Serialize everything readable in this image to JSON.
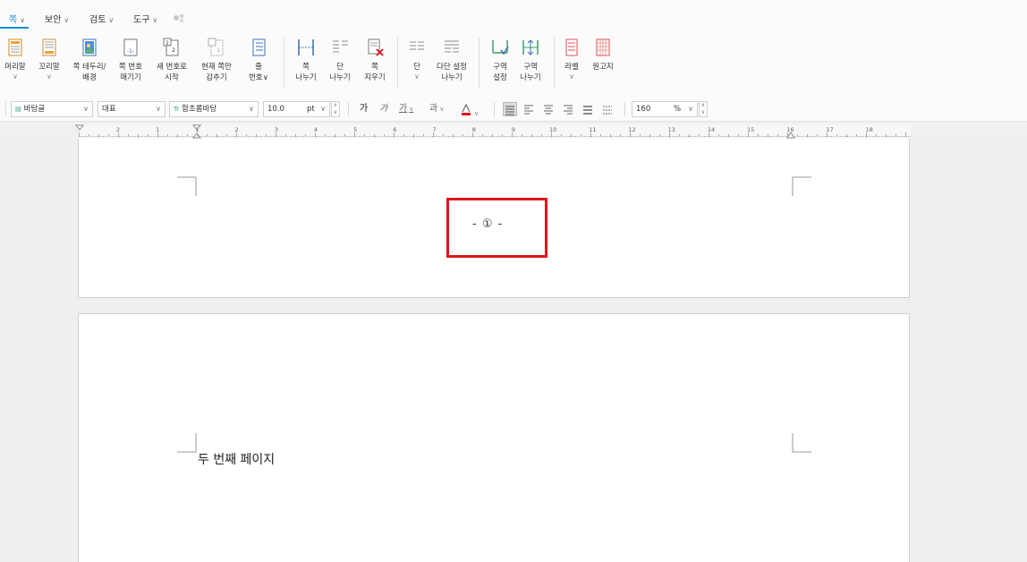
{
  "menu": {
    "tabs": [
      {
        "label": "쪽",
        "active": true
      },
      {
        "label": "보안",
        "active": false
      },
      {
        "label": "검토",
        "active": false
      },
      {
        "label": "도구",
        "active": false
      }
    ]
  },
  "ribbon": {
    "buttons": [
      {
        "label": "머리말",
        "icon": "header-icon",
        "dropdown": true
      },
      {
        "label": "꼬리말",
        "icon": "footer-icon",
        "dropdown": true
      },
      {
        "label": "쪽 테두리/\n배경",
        "icon": "page-border-icon",
        "dropdown": false
      },
      {
        "label": "쪽 번호\n매기기",
        "icon": "page-number-icon",
        "dropdown": false
      },
      {
        "label": "새 번호로\n시작",
        "icon": "new-number-icon",
        "dropdown": false
      },
      {
        "label": "현재 쪽만\n감추기",
        "icon": "hide-page-icon",
        "dropdown": false
      },
      {
        "label": "줄\n번호∨",
        "icon": "line-number-icon",
        "dropdown": false
      },
      {
        "label": "쪽\n나누기",
        "icon": "page-break-icon",
        "dropdown": false
      },
      {
        "label": "단\n나누기",
        "icon": "column-break-icon",
        "dropdown": false
      },
      {
        "label": "쪽\n지우기",
        "icon": "delete-page-icon",
        "dropdown": false
      },
      {
        "label": "단",
        "icon": "columns-icon",
        "dropdown": true
      },
      {
        "label": "다단 설정\n나누기",
        "icon": "multi-column-icon",
        "dropdown": false
      },
      {
        "label": "구역\n설정",
        "icon": "section-settings-icon",
        "dropdown": false
      },
      {
        "label": "구역\n나누기",
        "icon": "section-break-icon",
        "dropdown": false
      },
      {
        "label": "라벨",
        "icon": "label-icon",
        "dropdown": true
      },
      {
        "label": "원고지",
        "icon": "manuscript-icon",
        "dropdown": false
      }
    ]
  },
  "format": {
    "style": "바탕글",
    "language": "대표",
    "font": "함초롬바탕",
    "font_size": "10.0",
    "size_unit": "pt",
    "char_buttons": [
      "가",
      "가",
      "가",
      "과"
    ],
    "line_spacing": "160",
    "line_spacing_unit": "%"
  },
  "ruler": {
    "numbers": [
      "2",
      "1",
      "1",
      "2",
      "3",
      "4",
      "5",
      "6",
      "7",
      "8",
      "9",
      "10",
      "11",
      "12",
      "13",
      "14",
      "15",
      "16",
      "17",
      "18"
    ]
  },
  "document": {
    "page1_number": "- ① -",
    "page2_text": "두 번째 페이지"
  },
  "colors": {
    "accent": "#1a8fd8",
    "highlight": "#e0141e"
  }
}
